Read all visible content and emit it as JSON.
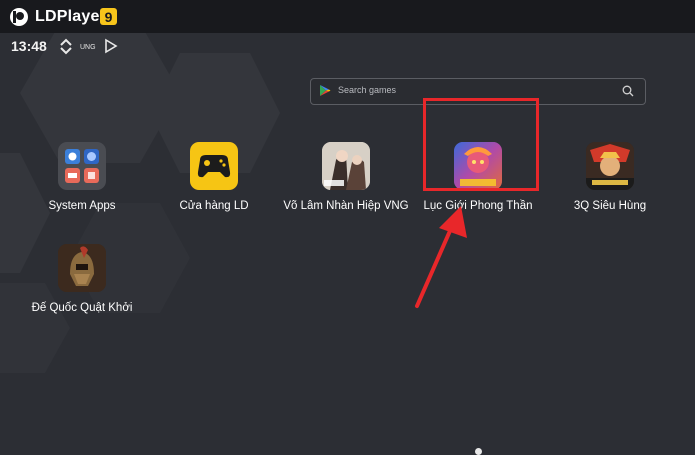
{
  "titlebar": {
    "app_name": "LDPlayer",
    "version": "9",
    "logo_icon": "ldplayer-logo-icon",
    "badge_color": "#f7c51b"
  },
  "statusbar": {
    "time": "13:48",
    "icons": [
      "network-sync-icon",
      "ung-label-icon",
      "play-outline-icon"
    ],
    "ung_text": "UNG"
  },
  "search": {
    "placeholder": "Search games",
    "left_icon": "google-play-icon",
    "right_icon": "search-icon"
  },
  "apps": [
    {
      "label": "System Apps",
      "icon": "system-apps-folder-icon"
    },
    {
      "label": "Cửa hàng LD",
      "icon": "gamepad-store-icon"
    },
    {
      "label": "Võ Lâm Nhàn Hiệp VNG",
      "icon": "vo-lam-game-icon"
    },
    {
      "label": "Lục Giới Phong Thần",
      "icon": "luc-gioi-game-icon",
      "highlighted": true
    },
    {
      "label": "3Q Siêu Hùng",
      "icon": "3q-game-icon"
    },
    {
      "label": "Đế Quốc Quật Khởi",
      "icon": "de-quoc-game-icon"
    }
  ],
  "annotation": {
    "highlight_color": "#e8272a",
    "arrow_color": "#e8272a"
  },
  "pager": {
    "current_page": 1
  }
}
